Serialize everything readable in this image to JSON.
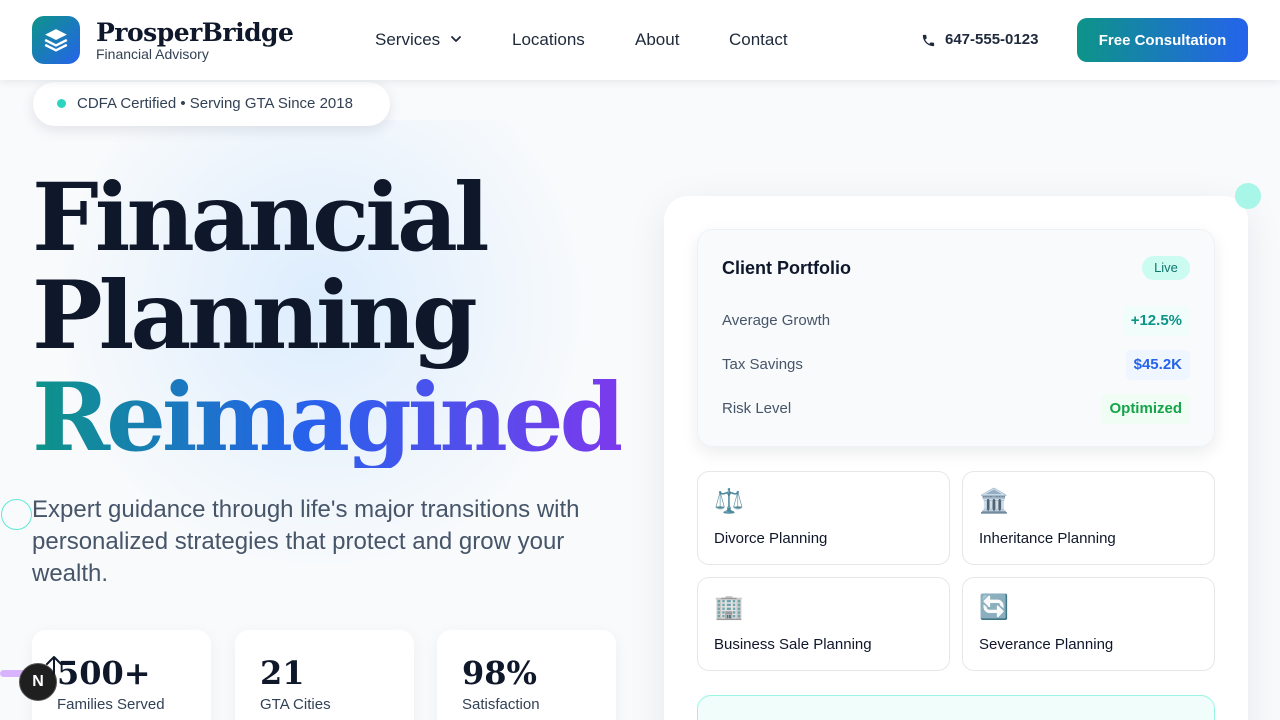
{
  "brand": {
    "name": "ProsperBridge",
    "tagline": "Financial Advisory",
    "logo_icon": "layers-icon"
  },
  "nav": {
    "links": [
      "Services",
      "Locations",
      "About",
      "Contact"
    ],
    "phone": "647-555-0123",
    "cta": "Free Consultation"
  },
  "badge": {
    "text": "CDFA Certified • Serving GTA Since 2018"
  },
  "hero": {
    "line1": "Financial",
    "line2": "Planning",
    "line3": "Reimagined",
    "subtitle": "Expert guidance through life's major transitions with personalized strategies that protect and grow your wealth."
  },
  "stats": [
    {
      "value": "500+",
      "label": "Families Served"
    },
    {
      "value": "21",
      "label": "GTA Cities"
    },
    {
      "value": "98%",
      "label": "Satisfaction"
    }
  ],
  "portfolio": {
    "title": "Client Portfolio",
    "status": "Live",
    "rows": [
      {
        "label": "Average Growth",
        "value": "+12.5%",
        "color": "#0d9488",
        "bg": "#f0fdfa"
      },
      {
        "label": "Tax Savings",
        "value": "$45.2K",
        "color": "#2563eb",
        "bg": "#eff6ff"
      },
      {
        "label": "Risk Level",
        "value": "Optimized",
        "color": "#16a34a",
        "bg": "#f0fdf4"
      }
    ]
  },
  "services": [
    {
      "icon": "⚖️",
      "icon_name": "scales-icon",
      "label": "Divorce Planning"
    },
    {
      "icon": "🏛️",
      "icon_name": "bank-icon",
      "label": "Inheritance Planning"
    },
    {
      "icon": "🏢",
      "icon_name": "office-building-icon",
      "label": "Business Sale Planning"
    },
    {
      "icon": "🔄",
      "icon_name": "cycle-arrows-icon",
      "label": "Severance Planning"
    }
  ],
  "widget": {
    "letter": "N"
  },
  "colors": {
    "teal": "#0d9488",
    "blue": "#2563eb",
    "purple": "#7c3aed",
    "navy": "#0f172a"
  }
}
